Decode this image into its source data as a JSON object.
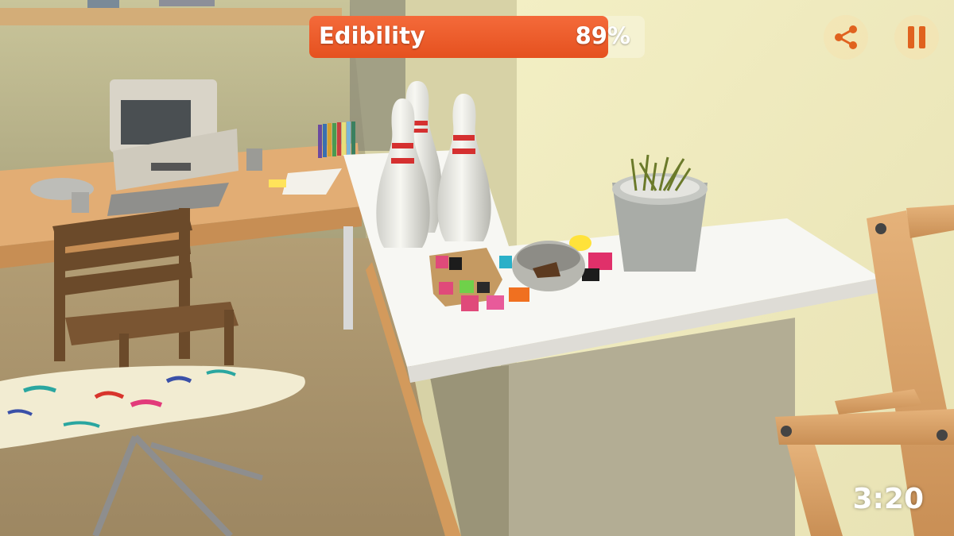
{
  "hud": {
    "edibility_label": "Edibility",
    "edibility_value": "89%",
    "edibility_fraction": 0.89,
    "timer": "3:20",
    "share_icon": "share-icon",
    "pause_icon": "pause-icon"
  },
  "colors": {
    "bar_fill": "#e85a27",
    "hud_text": "#ffffff",
    "button_icon": "#e0621f"
  }
}
